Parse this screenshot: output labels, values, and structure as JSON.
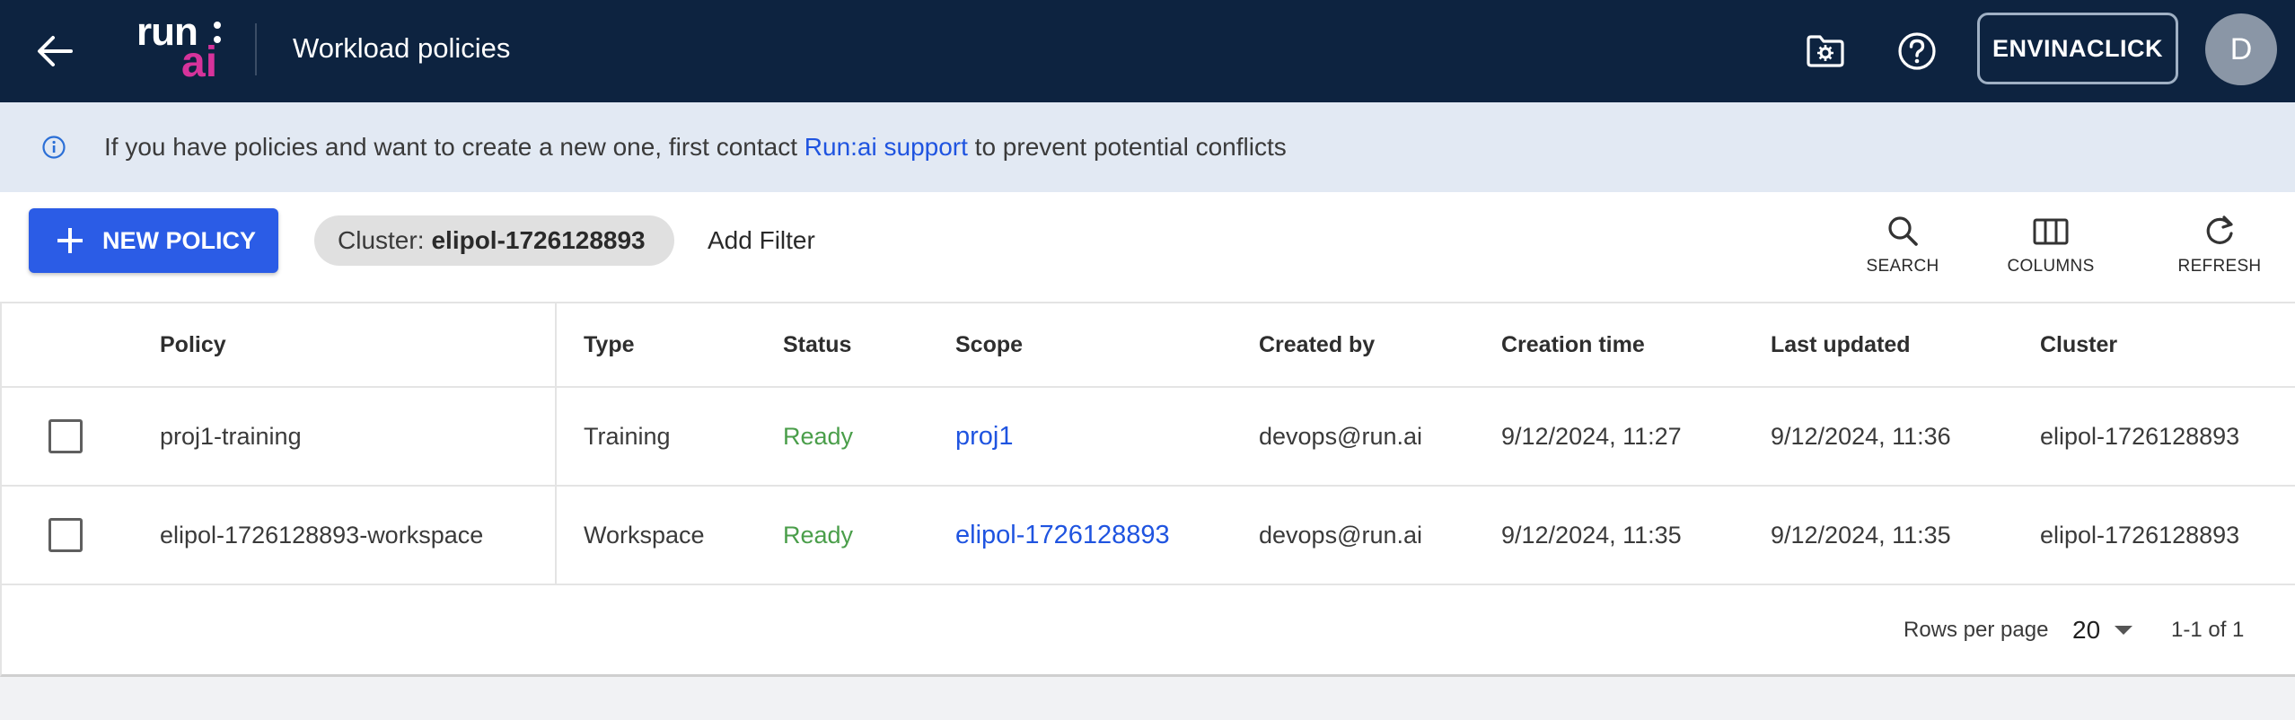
{
  "header": {
    "title": "Workload policies",
    "logo_top": "run",
    "logo_bottom": "ai",
    "account": "ENVINACLICK",
    "avatar_letter": "D"
  },
  "banner": {
    "text_before": "If you have policies and want to create a new one, first contact ",
    "link": "Run:ai support",
    "text_after": " to prevent potential conflicts"
  },
  "toolbar": {
    "new_policy": "NEW POLICY",
    "filter_chip_label": "Cluster:",
    "filter_chip_value": "elipol-1726128893",
    "add_filter": "Add Filter",
    "search": "SEARCH",
    "columns": "COLUMNS",
    "refresh": "REFRESH"
  },
  "table": {
    "columns": [
      "Policy",
      "Type",
      "Status",
      "Scope",
      "Created by",
      "Creation time",
      "Last updated",
      "Cluster"
    ],
    "rows": [
      {
        "policy": "proj1-training",
        "type": "Training",
        "status": "Ready",
        "scope": "proj1",
        "created_by": "devops@run.ai",
        "creation_time": "9/12/2024, 11:27",
        "last_updated": "9/12/2024, 11:36",
        "cluster": "elipol-1726128893"
      },
      {
        "policy": "elipol-1726128893-workspace",
        "type": "Workspace",
        "status": "Ready",
        "scope": "elipol-1726128893",
        "created_by": "devops@run.ai",
        "creation_time": "9/12/2024, 11:35",
        "last_updated": "9/12/2024, 11:35",
        "cluster": "elipol-1726128893"
      }
    ]
  },
  "pagination": {
    "rows_per_page_label": "Rows per page",
    "rows_per_page": "20",
    "range": "1-1 of 1"
  },
  "colors": {
    "header_bg": "#0d2340",
    "accent": "#2b5ce6",
    "brand_pink": "#d6339b",
    "ready": "#4a9e4a",
    "link": "#1f54e0"
  }
}
